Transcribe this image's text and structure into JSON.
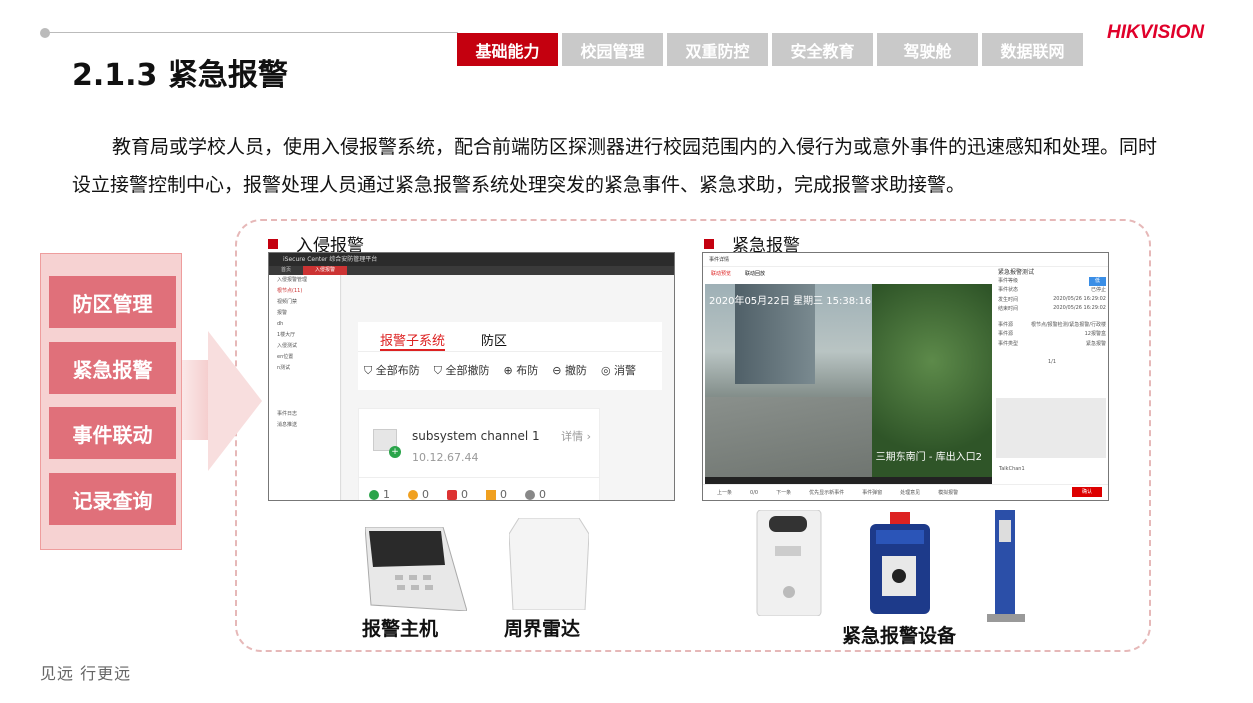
{
  "header": {
    "title": "2.1.3 紧急报警",
    "logo": "HIKVISION",
    "tabs": [
      {
        "label": "基础能力",
        "active": true
      },
      {
        "label": "校园管理",
        "active": false
      },
      {
        "label": "双重防控",
        "active": false
      },
      {
        "label": "安全教育",
        "active": false
      },
      {
        "label": "驾驶舱",
        "active": false
      },
      {
        "label": "数据联网",
        "active": false
      }
    ]
  },
  "intro": "教育局或学校人员，使用入侵报警系统，配合前端防区探测器进行校园范围内的入侵行为或意外事件的迅速感知和处理。同时设立接警控制中心，报警处理人员通过紧急报警系统处理突发的紧急事件、紧急求助，完成报警求助接警。",
  "left_panel": [
    "防区管理",
    "紧急报警",
    "事件联动",
    "记录查询"
  ],
  "section1": {
    "heading": "入侵报警",
    "app": {
      "title_bar": "iSecure Center 综合安防管理平台",
      "tabs": [
        "首页",
        "入侵报警"
      ],
      "sidebar": [
        "入侵报警管理",
        "根节点(11)",
        "视频门禁",
        "报警",
        "dh",
        "1楼大厅",
        "入侵测试",
        "en位置",
        "n测试",
        "事件日志",
        "消息推送"
      ],
      "subtabs": [
        "报警子系统",
        "防区"
      ],
      "ops": [
        "全部布防",
        "全部撤防",
        "布防",
        "撤防",
        "消警"
      ],
      "channel_name": "subsystem channel 1",
      "channel_ip": "10.12.67.44",
      "detail": "详情 ›",
      "stats": [
        "1",
        "0",
        "0",
        "0",
        "0"
      ]
    },
    "devices": [
      "报警主机",
      "周界雷达"
    ]
  },
  "section2": {
    "heading": "紧急报警",
    "app": {
      "window_title": "事件详情",
      "tabs": [
        "联动预览",
        "联动回放"
      ],
      "video_timestamp": "2020年05月22日 星期三 15:38:16",
      "video_caption": "三期东南门 - 库出入口2",
      "right_title": "紧急报警测试",
      "right_rows": [
        [
          "事件等级",
          "低"
        ],
        [
          "事件状态",
          "已停止"
        ],
        [
          "发生时间",
          "2020/05/26 16:29:02"
        ],
        [
          "结束时间",
          "2020/05/26 16:29:02"
        ],
        [
          "事件源",
          "根节点/报警检测/紧急报警/行政楼"
        ],
        [
          "事件源",
          "12报警盒"
        ],
        [
          "事件类型",
          "紧急报警"
        ]
      ],
      "pager": "1/1",
      "talk": "TalkChan1",
      "footer": [
        "上一条",
        "0/0",
        "下一条",
        "优先显示新事件",
        "事件弹窗",
        "处理意见",
        "模拟报警"
      ],
      "confirm": "确认"
    },
    "devices": [
      "紧急报警设备"
    ]
  },
  "footer": "见远 行更远",
  "colors": {
    "brand": "#c4000f",
    "panel": "#e0707a",
    "tab_inactive": "#c9c9c9"
  }
}
